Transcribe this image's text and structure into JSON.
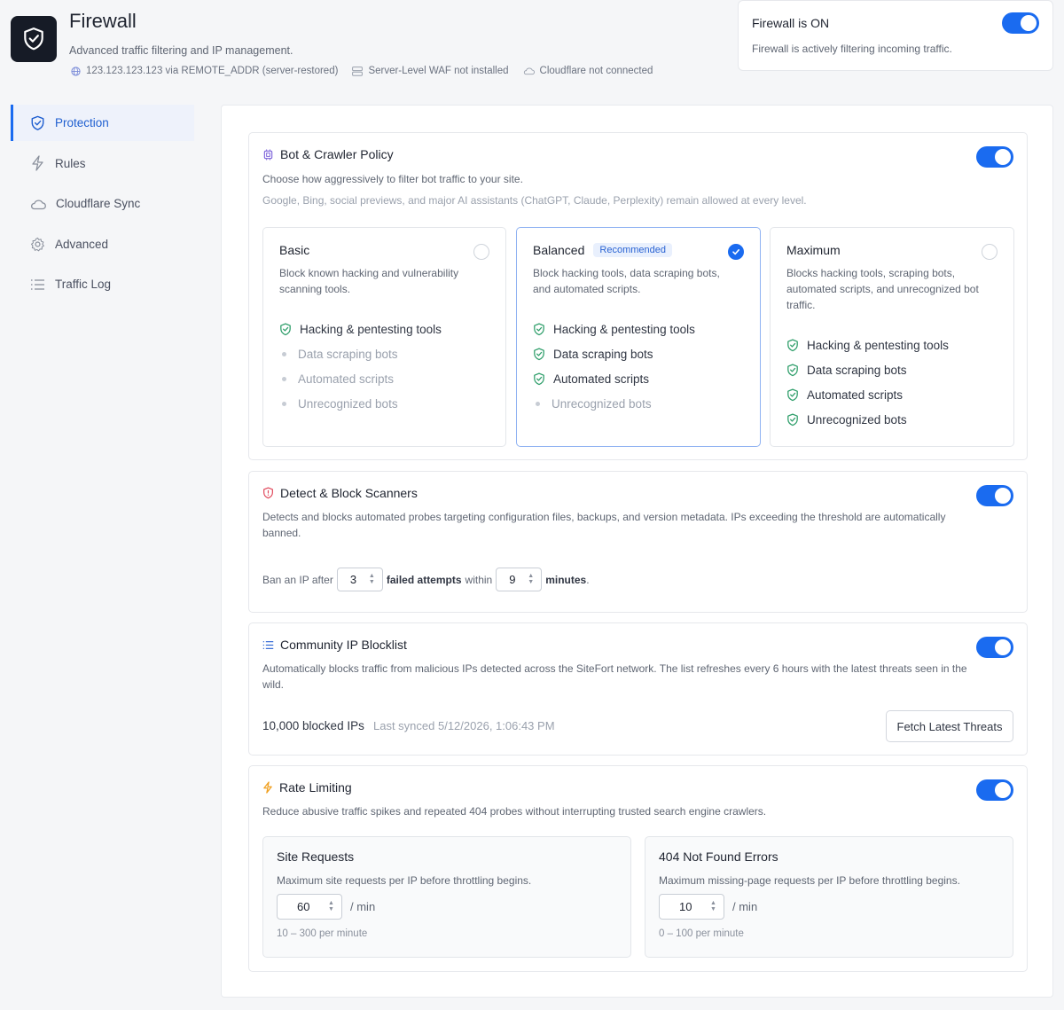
{
  "header": {
    "title": "Firewall",
    "subtitle": "Advanced traffic filtering and IP management.",
    "status": {
      "ip": "123.123.123.123 via REMOTE_ADDR (server-restored)",
      "waf": "Server-Level WAF not installed",
      "cloudflare": "Cloudflare not connected"
    }
  },
  "firewall_status": {
    "title": "Firewall is ON",
    "description": "Firewall is actively filtering incoming traffic.",
    "enabled": true
  },
  "sidebar": {
    "items": [
      {
        "label": "Protection",
        "icon": "shield-check-icon",
        "active": true
      },
      {
        "label": "Rules",
        "icon": "lightning-icon",
        "active": false
      },
      {
        "label": "Cloudflare Sync",
        "icon": "cloud-icon",
        "active": false
      },
      {
        "label": "Advanced",
        "icon": "gear-icon",
        "active": false
      },
      {
        "label": "Traffic Log",
        "icon": "list-icon",
        "active": false
      }
    ]
  },
  "bot_policy": {
    "title": "Bot & Crawler Policy",
    "description": "Choose how aggressively to filter bot traffic to your site.",
    "note": "Google, Bing, social previews, and major AI assistants (ChatGPT, Claude, Perplexity) remain allowed at every level.",
    "enabled": true,
    "levels": [
      {
        "name": "Basic",
        "badge": "",
        "description": "Block known hacking and vulnerability scanning tools.",
        "selected": false,
        "features": [
          {
            "label": "Hacking & pentesting tools",
            "on": true
          },
          {
            "label": "Data scraping bots",
            "on": false
          },
          {
            "label": "Automated scripts",
            "on": false
          },
          {
            "label": "Unrecognized bots",
            "on": false
          }
        ]
      },
      {
        "name": "Balanced",
        "badge": "Recommended",
        "description": "Block hacking tools, data scraping bots, and automated scripts.",
        "selected": true,
        "features": [
          {
            "label": "Hacking & pentesting tools",
            "on": true
          },
          {
            "label": "Data scraping bots",
            "on": true
          },
          {
            "label": "Automated scripts",
            "on": true
          },
          {
            "label": "Unrecognized bots",
            "on": false
          }
        ]
      },
      {
        "name": "Maximum",
        "badge": "",
        "description": "Blocks hacking tools, scraping bots, automated scripts, and unrecognized bot traffic.",
        "selected": false,
        "features": [
          {
            "label": "Hacking & pentesting tools",
            "on": true
          },
          {
            "label": "Data scraping bots",
            "on": true
          },
          {
            "label": "Automated scripts",
            "on": true
          },
          {
            "label": "Unrecognized bots",
            "on": true
          }
        ]
      }
    ]
  },
  "scanners": {
    "title": "Detect & Block Scanners",
    "description": "Detects and blocks automated probes targeting configuration files, backups, and version metadata. IPs exceeding the threshold are automatically banned.",
    "enabled": true,
    "ban_prefix": "Ban an IP after",
    "attempts": "3",
    "attempts_label": "failed attempts",
    "within_label": "within",
    "minutes": "9",
    "minutes_label": "minutes",
    "period": "."
  },
  "blocklist": {
    "title": "Community IP Blocklist",
    "description": "Automatically blocks traffic from malicious IPs detected across the SiteFort network. The list refreshes every 6 hours with the latest threats seen in the wild.",
    "enabled": true,
    "blocked_count": "10,000 blocked IPs",
    "last_synced": "Last synced 5/12/2026, 1:06:43 PM",
    "button_label": "Fetch Latest Threats"
  },
  "rate_limiting": {
    "title": "Rate Limiting",
    "description": "Reduce abusive traffic spikes and repeated 404 probes without interrupting trusted search engine crawlers.",
    "enabled": true,
    "site_requests": {
      "title": "Site Requests",
      "description": "Maximum site requests per IP before throttling begins.",
      "value": "60",
      "unit": "/ min",
      "range": "10 – 300 per minute"
    },
    "not_found": {
      "title": "404 Not Found Errors",
      "description": "Maximum missing-page requests per IP before throttling begins.",
      "value": "10",
      "unit": "/ min",
      "range": "0 – 100 per minute"
    }
  },
  "colors": {
    "accent": "#1a6bf0",
    "success": "#2e9e6a",
    "danger": "#e0475a",
    "warning": "#f0a020",
    "purple": "#7b61d9"
  }
}
